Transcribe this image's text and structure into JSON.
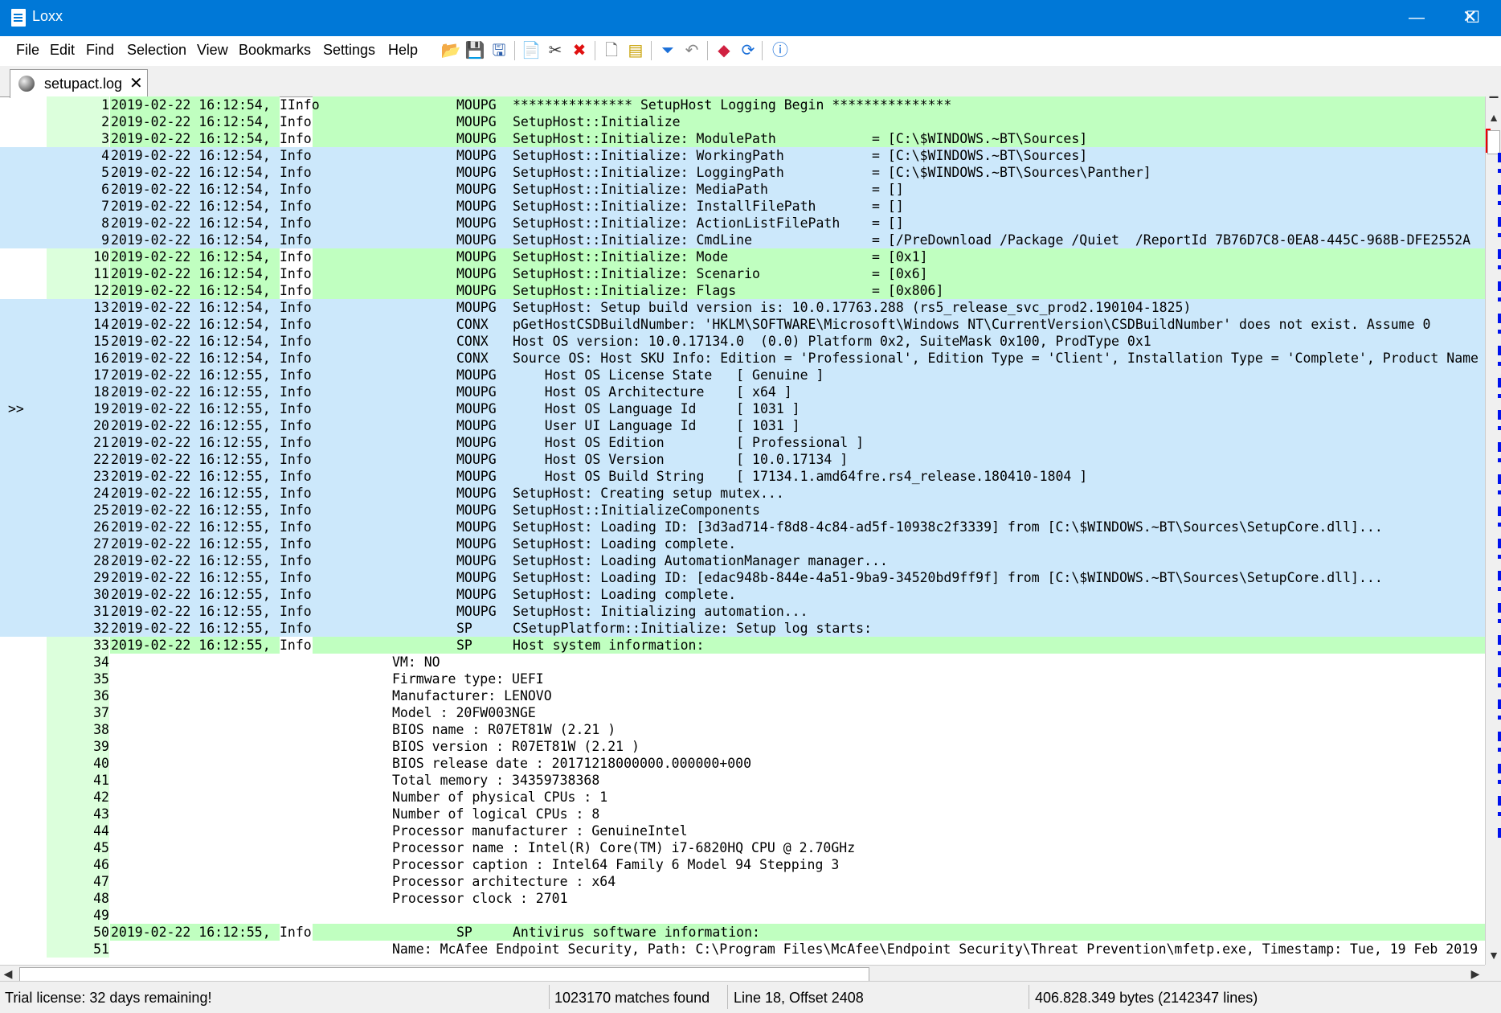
{
  "window": {
    "title": "Loxx",
    "minimize": "—",
    "maximize": "☐",
    "close": "✕"
  },
  "menu": [
    "File",
    "Edit",
    "Find",
    "Selection",
    "View",
    "Bookmarks",
    "Settings",
    "Help"
  ],
  "toolbar": [
    {
      "name": "open-icon",
      "glyph": "📂",
      "color": "#d9a000"
    },
    {
      "name": "save-icon",
      "glyph": "💾",
      "color": "#555"
    },
    {
      "name": "save-as-icon",
      "glyph": "🖫",
      "color": "#2a5caa"
    },
    {
      "name": "copy-icon",
      "glyph": "📄",
      "color": "#4a7ac8"
    },
    {
      "name": "cut-icon",
      "glyph": "✂",
      "color": "#333"
    },
    {
      "name": "delete-icon",
      "glyph": "✖",
      "color": "#e01010"
    },
    {
      "name": "new-document-icon",
      "glyph": "🗋",
      "color": "#666"
    },
    {
      "name": "highlight-icon",
      "glyph": "▤",
      "color": "#c8a000"
    },
    {
      "name": "filter-icon",
      "glyph": "⏷",
      "color": "#1a6fd8"
    },
    {
      "name": "undo-icon",
      "glyph": "↶",
      "color": "#888"
    },
    {
      "name": "eraser-icon",
      "glyph": "◆",
      "color": "#d02040"
    },
    {
      "name": "refresh-icon",
      "glyph": "⟳",
      "color": "#1a6fd8"
    },
    {
      "name": "info-icon",
      "glyph": "ⓘ",
      "color": "#1a6fd8"
    }
  ],
  "tab": {
    "label": "setupact.log",
    "close": "✕"
  },
  "current_line_marker": ">>",
  "lines": [
    {
      "n": "1",
      "ts": "2019-02-22 16:12:54,",
      "lvl": "IInfo",
      "src": "MOUPG",
      "msg": "*************** SetupHost Logging Begin ***************",
      "bg": "green"
    },
    {
      "n": "2",
      "ts": "2019-02-22 16:12:54,",
      "lvl": "Info",
      "src": "MOUPG",
      "msg": "SetupHost::Initialize",
      "bg": "green"
    },
    {
      "n": "3",
      "ts": "2019-02-22 16:12:54,",
      "lvl": "Info",
      "src": "MOUPG",
      "msg": "SetupHost::Initialize: ModulePath            = [C:\\$WINDOWS.~BT\\Sources]",
      "bg": "green"
    },
    {
      "n": "4",
      "ts": "2019-02-22 16:12:54,",
      "lvl": "Info",
      "src": "MOUPG",
      "msg": "SetupHost::Initialize: WorkingPath           = [C:\\$WINDOWS.~BT\\Sources]",
      "bg": "blue"
    },
    {
      "n": "5",
      "ts": "2019-02-22 16:12:54,",
      "lvl": "Info",
      "src": "MOUPG",
      "msg": "SetupHost::Initialize: LoggingPath           = [C:\\$WINDOWS.~BT\\Sources\\Panther]",
      "bg": "blue"
    },
    {
      "n": "6",
      "ts": "2019-02-22 16:12:54,",
      "lvl": "Info",
      "src": "MOUPG",
      "msg": "SetupHost::Initialize: MediaPath             = []",
      "bg": "blue"
    },
    {
      "n": "7",
      "ts": "2019-02-22 16:12:54,",
      "lvl": "Info",
      "src": "MOUPG",
      "msg": "SetupHost::Initialize: InstallFilePath       = []",
      "bg": "blue"
    },
    {
      "n": "8",
      "ts": "2019-02-22 16:12:54,",
      "lvl": "Info",
      "src": "MOUPG",
      "msg": "SetupHost::Initialize: ActionListFilePath    = []",
      "bg": "blue"
    },
    {
      "n": "9",
      "ts": "2019-02-22 16:12:54,",
      "lvl": "Info",
      "src": "MOUPG",
      "msg": "SetupHost::Initialize: CmdLine               = [/PreDownload /Package /Quiet  /ReportId 7B76D7C8-0EA8-445C-968B-DFE2552A",
      "bg": "blue"
    },
    {
      "n": "10",
      "ts": "2019-02-22 16:12:54,",
      "lvl": "Info",
      "src": "MOUPG",
      "msg": "SetupHost::Initialize: Mode                  = [0x1]",
      "bg": "green"
    },
    {
      "n": "11",
      "ts": "2019-02-22 16:12:54,",
      "lvl": "Info",
      "src": "MOUPG",
      "msg": "SetupHost::Initialize: Scenario              = [0x6]",
      "bg": "green"
    },
    {
      "n": "12",
      "ts": "2019-02-22 16:12:54,",
      "lvl": "Info",
      "src": "MOUPG",
      "msg": "SetupHost::Initialize: Flags                 = [0x806]",
      "bg": "green"
    },
    {
      "n": "13",
      "ts": "2019-02-22 16:12:54,",
      "lvl": "Info",
      "src": "MOUPG",
      "msg": "SetupHost: Setup build version is: 10.0.17763.288 (rs5_release_svc_prod2.190104-1825)",
      "bg": "blue"
    },
    {
      "n": "14",
      "ts": "2019-02-22 16:12:54,",
      "lvl": "Info",
      "src": "CONX",
      "msg": "pGetHostCSDBuildNumber: 'HKLM\\SOFTWARE\\Microsoft\\Windows NT\\CurrentVersion\\CSDBuildNumber' does not exist. Assume 0",
      "bg": "blue"
    },
    {
      "n": "15",
      "ts": "2019-02-22 16:12:54,",
      "lvl": "Info",
      "src": "CONX",
      "msg": "Host OS version: 10.0.17134.0  (0.0) Platform 0x2, SuiteMask 0x100, ProdType 0x1",
      "bg": "blue"
    },
    {
      "n": "16",
      "ts": "2019-02-22 16:12:54,",
      "lvl": "Info",
      "src": "CONX",
      "msg": "Source OS: Host SKU Info: Edition = 'Professional', Edition Type = 'Client', Installation Type = 'Complete', Product Name",
      "bg": "blue"
    },
    {
      "n": "17",
      "ts": "2019-02-22 16:12:55,",
      "lvl": "Info",
      "src": "MOUPG",
      "msg": "    Host OS License State   [ Genuine ]",
      "bg": "blue"
    },
    {
      "n": "18",
      "ts": "2019-02-22 16:12:55,",
      "lvl": "Info",
      "src": "MOUPG",
      "msg": "    Host OS Architecture    [ x64 ]",
      "bg": "blue"
    },
    {
      "n": "19",
      "ts": "2019-02-22 16:12:55,",
      "lvl": "Info",
      "src": "MOUPG",
      "msg": "    Host OS Language Id     [ 1031 ]",
      "bg": "blue",
      "marker": true
    },
    {
      "n": "20",
      "ts": "2019-02-22 16:12:55,",
      "lvl": "Info",
      "src": "MOUPG",
      "msg": "    User UI Language Id     [ 1031 ]",
      "bg": "blue"
    },
    {
      "n": "21",
      "ts": "2019-02-22 16:12:55,",
      "lvl": "Info",
      "src": "MOUPG",
      "msg": "    Host OS Edition         [ Professional ]",
      "bg": "blue"
    },
    {
      "n": "22",
      "ts": "2019-02-22 16:12:55,",
      "lvl": "Info",
      "src": "MOUPG",
      "msg": "    Host OS Version         [ 10.0.17134 ]",
      "bg": "blue"
    },
    {
      "n": "23",
      "ts": "2019-02-22 16:12:55,",
      "lvl": "Info",
      "src": "MOUPG",
      "msg": "    Host OS Build String    [ 17134.1.amd64fre.rs4_release.180410-1804 ]",
      "bg": "blue"
    },
    {
      "n": "24",
      "ts": "2019-02-22 16:12:55,",
      "lvl": "Info",
      "src": "MOUPG",
      "msg": "SetupHost: Creating setup mutex...",
      "bg": "blue"
    },
    {
      "n": "25",
      "ts": "2019-02-22 16:12:55,",
      "lvl": "Info",
      "src": "MOUPG",
      "msg": "SetupHost::InitializeComponents",
      "bg": "blue"
    },
    {
      "n": "26",
      "ts": "2019-02-22 16:12:55,",
      "lvl": "Info",
      "src": "MOUPG",
      "msg": "SetupHost: Loading ID: [3d3ad714-f8d8-4c84-ad5f-10938c2f3339] from [C:\\$WINDOWS.~BT\\Sources\\SetupCore.dll]...",
      "bg": "blue"
    },
    {
      "n": "27",
      "ts": "2019-02-22 16:12:55,",
      "lvl": "Info",
      "src": "MOUPG",
      "msg": "SetupHost: Loading complete.",
      "bg": "blue"
    },
    {
      "n": "28",
      "ts": "2019-02-22 16:12:55,",
      "lvl": "Info",
      "src": "MOUPG",
      "msg": "SetupHost: Loading AutomationManager manager...",
      "bg": "blue"
    },
    {
      "n": "29",
      "ts": "2019-02-22 16:12:55,",
      "lvl": "Info",
      "src": "MOUPG",
      "msg": "SetupHost: Loading ID: [edac948b-844e-4a51-9ba9-34520bd9ff9f] from [C:\\$WINDOWS.~BT\\Sources\\SetupCore.dll]...",
      "bg": "blue"
    },
    {
      "n": "30",
      "ts": "2019-02-22 16:12:55,",
      "lvl": "Info",
      "src": "MOUPG",
      "msg": "SetupHost: Loading complete.",
      "bg": "blue"
    },
    {
      "n": "31",
      "ts": "2019-02-22 16:12:55,",
      "lvl": "Info",
      "src": "MOUPG",
      "msg": "SetupHost: Initializing automation...",
      "bg": "blue"
    },
    {
      "n": "32",
      "ts": "2019-02-22 16:12:55,",
      "lvl": "Info",
      "src": "SP",
      "msg": "CSetupPlatform::Initialize: Setup log starts:",
      "bg": "blue"
    },
    {
      "n": "33",
      "ts": "2019-02-22 16:12:55,",
      "lvl": "Info",
      "src": "SP",
      "msg": "Host system information:",
      "bg": "green"
    },
    {
      "n": "34",
      "cont": "VM: NO"
    },
    {
      "n": "35",
      "cont": "Firmware type: UEFI"
    },
    {
      "n": "36",
      "cont": "Manufacturer: LENOVO"
    },
    {
      "n": "37",
      "cont": "Model : 20FW003NGE"
    },
    {
      "n": "38",
      "cont": "BIOS name : R07ET81W (2.21 )"
    },
    {
      "n": "39",
      "cont": "BIOS version : R07ET81W (2.21 )"
    },
    {
      "n": "40",
      "cont": "BIOS release date : 20171218000000.000000+000"
    },
    {
      "n": "41",
      "cont": "Total memory : 34359738368"
    },
    {
      "n": "42",
      "cont": "Number of physical CPUs : 1"
    },
    {
      "n": "43",
      "cont": "Number of logical CPUs : 8"
    },
    {
      "n": "44",
      "cont": "Processor manufacturer : GenuineIntel"
    },
    {
      "n": "45",
      "cont": "Processor name : Intel(R) Core(TM) i7-6820HQ CPU @ 2.70GHz"
    },
    {
      "n": "46",
      "cont": "Processor caption : Intel64 Family 6 Model 94 Stepping 3"
    },
    {
      "n": "47",
      "cont": "Processor architecture : x64"
    },
    {
      "n": "48",
      "cont": "Processor clock : 2701"
    },
    {
      "n": "49",
      "cont": ""
    },
    {
      "n": "50",
      "ts": "2019-02-22 16:12:55,",
      "lvl": "Info",
      "src": "SP",
      "msg": "Antivirus software information:",
      "bg": "green"
    },
    {
      "n": "51",
      "cont": "Name: McAfee Endpoint Security, Path: C:\\Program Files\\McAfee\\Endpoint Security\\Threat Prevention\\mfetp.exe, Timestamp: Tue, 19 Feb 2019"
    }
  ],
  "status": {
    "license": "Trial license: 32 days remaining!",
    "matches": "1023170 matches found",
    "position": "Line 18, Offset 2408",
    "size": "406.828.349 bytes (2142347 lines)"
  },
  "colors": {
    "titlebar": "#0078d7",
    "green_row": "#c0ffc0",
    "blue_row": "#cce8fb"
  }
}
